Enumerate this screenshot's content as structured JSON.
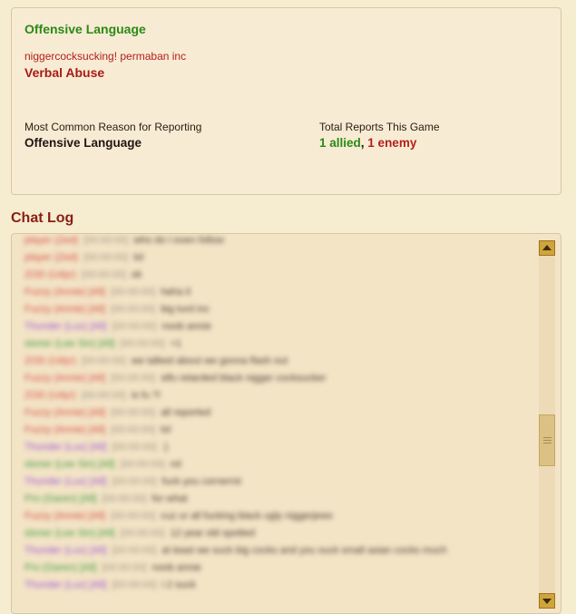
{
  "report": {
    "top_right_text": "",
    "category_title": "Offensive Language",
    "message": "niggercocksucking! permaban inc",
    "secondary_category": "Verbal Abuse",
    "most_common_label": "Most Common Reason for Reporting",
    "most_common_value": "Offensive Language",
    "total_reports_label": "Total Reports This Game",
    "allied_text": "1 allied",
    "separator": ", ",
    "enemy_text": "1 enemy",
    "colors": {
      "allied": "#2a8a16",
      "enemy": "#b3201d",
      "title": "#8a1d16",
      "panel": "#f7ebd3"
    }
  },
  "chat_log": {
    "title": "Chat Log",
    "lines": [
      {
        "name": "player (Zed)",
        "time": "[00:00:00]",
        "text": "who do I even follow",
        "color": "red"
      },
      {
        "name": "player (Zed)",
        "time": "[00:00:00]",
        "text": "lol",
        "color": "red"
      },
      {
        "name": "ZOD (Udyr)",
        "time": "[00:00:00]",
        "text": "ok",
        "color": "red"
      },
      {
        "name": "Fuzzy (Annie) [All]",
        "time": "[00:00:00]",
        "text": "haha it",
        "color": "red"
      },
      {
        "name": "Fuzzy (Annie) [All]",
        "time": "[00:00:00]",
        "text": "big turd inc",
        "color": "red"
      },
      {
        "name": "Thunder (Lux) [All]",
        "time": "[00:00:00]",
        "text": "noob annie",
        "color": "purple"
      },
      {
        "name": "stoner (Lee Sin) [All]",
        "time": "[00:00:00]",
        "text": "+1",
        "color": "green"
      },
      {
        "name": "ZOD (Udyr)",
        "time": "[00:00:00]",
        "text": "we talked about we gonna flash out",
        "color": "red"
      },
      {
        "name": "Fuzzy (Annie) [All]",
        "time": "[00:00:00]",
        "text": "stfu retarded black nigger cocksucker",
        "color": "red"
      },
      {
        "name": "ZOD (Udyr)",
        "time": "[00:00:00]",
        "text": "is fu ?!",
        "color": "red"
      },
      {
        "name": "Fuzzy (Annie) [All]",
        "time": "[00:00:00]",
        "text": "all reported",
        "color": "red"
      },
      {
        "name": "Fuzzy (Annie) [All]",
        "time": "[00:00:00]",
        "text": "lol",
        "color": "red"
      },
      {
        "name": "Thunder (Lux) [All]",
        "time": "[00:00:00]",
        "text": ":)",
        "color": "purple"
      },
      {
        "name": "stoner (Lee Sin) [All]",
        "time": "[00:00:00]",
        "text": "rol",
        "color": "green"
      },
      {
        "name": "Thunder (Lux) [All]",
        "time": "[00:00:00]",
        "text": "fuck you cornerrst",
        "color": "purple"
      },
      {
        "name": "Pro (Garen) [All]",
        "time": "[00:00:00]",
        "text": "for what",
        "color": "green"
      },
      {
        "name": "Fuzzy (Annie) [All]",
        "time": "[00:00:00]",
        "text": "cuz ur all fucking black ugly niggerjews",
        "color": "red"
      },
      {
        "name": "stoner (Lee Sin) [All]",
        "time": "[00:00:00]",
        "text": "12 year old spotted",
        "color": "green"
      },
      {
        "name": "Thunder (Lux) [All]",
        "time": "[00:00:00]",
        "text": "at least we suck big cocks and you suck small asian cocks much",
        "color": "purple"
      },
      {
        "name": "Pro (Garen) [All]",
        "time": "[00:00:00]",
        "text": "noob annie",
        "color": "green"
      },
      {
        "name": "Thunder (Lux) [All]",
        "time": "[00:00:00]",
        "text": "i 2 suck",
        "color": "purple"
      }
    ]
  }
}
